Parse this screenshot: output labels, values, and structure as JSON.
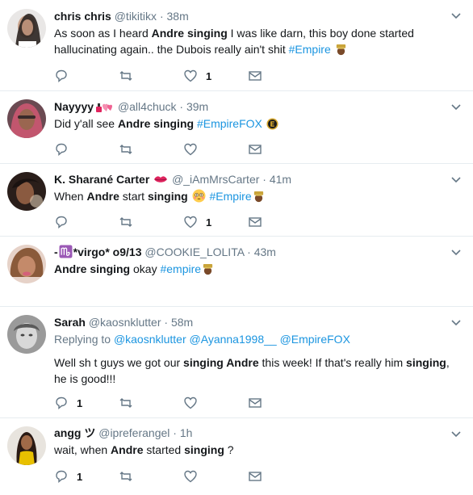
{
  "tweets": [
    {
      "name": "chris chris",
      "handle": "@tikitikx",
      "time": "38m",
      "text_a": "As soon as I heard ",
      "text_b": "Andre singing",
      "text_c": " I was like darn,  this boy done started hallucinating again.. the Dubois really ain't shit  ",
      "hashtag": "#Empire",
      "reply_count": "",
      "like_count": "1"
    },
    {
      "name": "Nayyyy",
      "handle": "@all4chuck",
      "time": "39m",
      "text_a": "Did y'all see ",
      "text_b": "Andre singing",
      "text_c": " ",
      "hashtag": "#EmpireFOX",
      "reply_count": "",
      "like_count": ""
    },
    {
      "name": "K. Sharané Carter",
      "handle": "@_iAmMrsCarter",
      "time": "41m",
      "text_a": "When ",
      "text_b": "Andre",
      "text_c": " start ",
      "text_d": "singing",
      "text_e": " ",
      "hashtag": "#Empire",
      "reply_count": "",
      "like_count": "1"
    },
    {
      "name": "-",
      "name_b": "*virgo* o9/13",
      "handle": "@COOKIE_LOLITA",
      "time": "43m",
      "text_b": "Andre singing",
      "text_c": " okay ",
      "hashtag": "#empire",
      "reply_count": "",
      "like_count": ""
    },
    {
      "name": "Sarah",
      "handle": "@kaosnklutter",
      "time": "58m",
      "reply_label": "Replying to ",
      "reply_mentions": "@kaosnklutter @Ayanna1998__ @EmpireFOX",
      "text_a": "Well sh t guys we got our ",
      "text_b": "singing Andre",
      "text_c": " this week! If that's really him ",
      "text_d": "singing",
      "text_e": ", he is good!!!",
      "reply_count": "1",
      "like_count": ""
    },
    {
      "name": "angg ツ",
      "handle": "@ipreferangel",
      "time": "1h",
      "text_a": "wait, when ",
      "text_b": "Andre",
      "text_c": " started ",
      "text_d": "singing",
      "text_e": " ?",
      "reply_count": "1",
      "like_count": ""
    }
  ]
}
